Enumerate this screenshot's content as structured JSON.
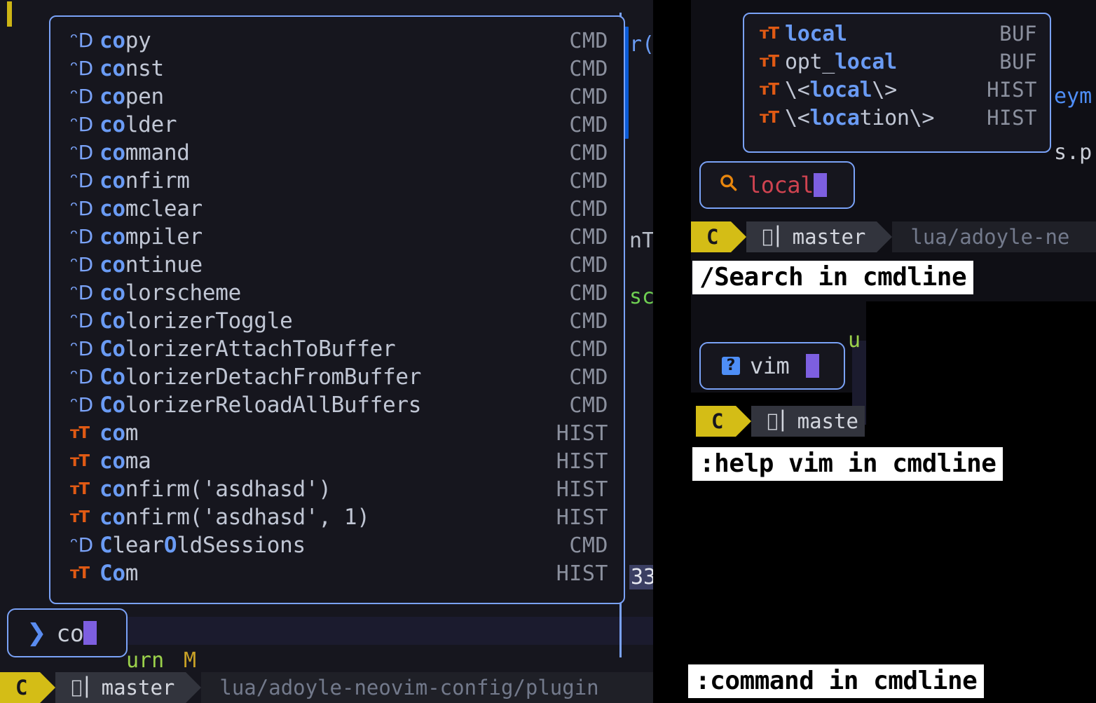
{
  "window": {
    "title": "Neovim cmdline completion demo",
    "panes": {
      "left_label": "editor-left",
      "right_label": "editor-right"
    }
  },
  "completion_popup": {
    "name": "cmdline-completion-menu",
    "items": [
      {
        "icon": "vim-cmd-icon",
        "icon_glyph": "ᵔD",
        "prefix": "co",
        "rest": "py",
        "kind": "CMD"
      },
      {
        "icon": "vim-cmd-icon",
        "icon_glyph": "ᵔD",
        "prefix": "co",
        "rest": "nst",
        "kind": "CMD"
      },
      {
        "icon": "vim-cmd-icon",
        "icon_glyph": "ᵔD",
        "prefix": "co",
        "rest": "pen",
        "kind": "CMD"
      },
      {
        "icon": "vim-cmd-icon",
        "icon_glyph": "ᵔD",
        "prefix": "co",
        "rest": "lder",
        "kind": "CMD"
      },
      {
        "icon": "vim-cmd-icon",
        "icon_glyph": "ᵔD",
        "prefix": "co",
        "rest": "mmand",
        "kind": "CMD"
      },
      {
        "icon": "vim-cmd-icon",
        "icon_glyph": "ᵔD",
        "prefix": "co",
        "rest": "nfirm",
        "kind": "CMD"
      },
      {
        "icon": "vim-cmd-icon",
        "icon_glyph": "ᵔD",
        "prefix": "co",
        "rest": "mclear",
        "kind": "CMD"
      },
      {
        "icon": "vim-cmd-icon",
        "icon_glyph": "ᵔD",
        "prefix": "co",
        "rest": "mpiler",
        "kind": "CMD"
      },
      {
        "icon": "vim-cmd-icon",
        "icon_glyph": "ᵔD",
        "prefix": "co",
        "rest": "ntinue",
        "kind": "CMD"
      },
      {
        "icon": "vim-cmd-icon",
        "icon_glyph": "ᵔD",
        "prefix": "co",
        "rest": "lorscheme",
        "kind": "CMD"
      },
      {
        "icon": "vim-cmd-icon",
        "icon_glyph": "ᵔD",
        "prefix": "Co",
        "rest": "lorizerToggle",
        "kind": "CMD"
      },
      {
        "icon": "vim-cmd-icon",
        "icon_glyph": "ᵔD",
        "prefix": "Co",
        "rest": "lorizerAttachToBuffer",
        "kind": "CMD"
      },
      {
        "icon": "vim-cmd-icon",
        "icon_glyph": "ᵔD",
        "prefix": "Co",
        "rest": "lorizerDetachFromBuffer",
        "kind": "CMD"
      },
      {
        "icon": "vim-cmd-icon",
        "icon_glyph": "ᵔD",
        "prefix": "Co",
        "rest": "lorizerReloadAllBuffers",
        "kind": "CMD"
      },
      {
        "icon": "history-text-icon",
        "icon_glyph": "ᴛT",
        "prefix": "co",
        "rest": "m",
        "kind": "HIST"
      },
      {
        "icon": "history-text-icon",
        "icon_glyph": "ᴛT",
        "prefix": "co",
        "rest": "ma",
        "kind": "HIST"
      },
      {
        "icon": "history-text-icon",
        "icon_glyph": "ᴛT",
        "prefix": "co",
        "rest": "nfirm('asdhasd')",
        "kind": "HIST"
      },
      {
        "icon": "history-text-icon",
        "icon_glyph": "ᴛT",
        "prefix": "co",
        "rest": "nfirm('asdhasd', 1)",
        "kind": "HIST"
      },
      {
        "icon": "vim-cmd-icon",
        "icon_glyph": "ᵔD",
        "prefix": "C",
        "rest": "lear",
        "prefix2": "O",
        "rest2": "ldSessions",
        "kind": "CMD"
      },
      {
        "icon": "history-text-icon",
        "icon_glyph": "ᴛT",
        "prefix": "Co",
        "rest": "m",
        "kind": "HIST"
      }
    ]
  },
  "cmdline": {
    "name": "command-line-prompt",
    "chevron": "❯",
    "text": "co"
  },
  "buffer_popup": {
    "name": "search-completion-menu",
    "items": [
      {
        "icon": "history-text-icon",
        "pre": "",
        "match": "local",
        "post": "",
        "kind": "BUF"
      },
      {
        "icon": "history-text-icon",
        "pre": "opt_",
        "match": "local",
        "post": "",
        "kind": "BUF"
      },
      {
        "icon": "history-text-icon",
        "pre": "\\<",
        "match": "local",
        "post": "\\>",
        "kind": "HIST"
      },
      {
        "icon": "history-text-icon",
        "pre": "\\<",
        "match": "loca",
        "post": "tion\\>",
        "kind": "HIST"
      }
    ]
  },
  "search_box": {
    "name": "search-prompt",
    "icon": "magnifier-icon",
    "icon_glyph": "🔍",
    "text": "local"
  },
  "help_box": {
    "name": "help-prompt",
    "icon": "question-badge-icon",
    "icon_glyph": "?",
    "text": "vim"
  },
  "statusline": {
    "mode": "C",
    "branch_icon": "git-branch-icon",
    "branch": "master",
    "file_full": "lua/adoyle-neovim-config/plugin",
    "file_right": "lua/adoyle-ne",
    "file_right2": "maste"
  },
  "captions": {
    "search": "/Search in cmdline",
    "help": ":help vim in cmdline",
    "command": ":command in cmdline"
  },
  "background_fragments": {
    "f_r_paren": "r(",
    "f_nT": "nT",
    "f_sc": "sc",
    "f_33": "33",
    "f_urn": "urn",
    "f_M": "M",
    "f_eym": "eym",
    "f_sp": "s.p",
    "f_u": "u"
  },
  "colors": {
    "popup_border": "#7aa2f7",
    "popup_bg": "#16161e",
    "match_blue": "#6a9bf4",
    "hist_orange": "#e05a14",
    "cursor_purple": "#7d5fe0",
    "mode_yellow": "#d4bd16",
    "search_red": "#cf4350",
    "scrollbar_blue": "#0b5bd7",
    "kind_grey": "#8b909e"
  }
}
